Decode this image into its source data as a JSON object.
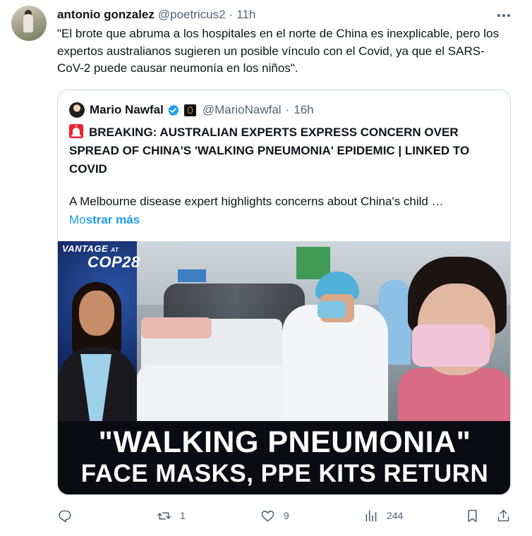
{
  "tweet": {
    "author_name": "antonio gonzalez",
    "author_handle": "@poetricus2",
    "separator": "·",
    "time": "11h",
    "text": "\"El brote que abruma a los hospitales en el norte de China es inexplicable, pero los expertos australianos sugieren un posible vínculo con el Covid, ya que el SARS-CoV-2 puede causar neumonía en los niños\"."
  },
  "quote": {
    "author_name": "Mario Nawfal",
    "author_handle": "@MarioNawfal",
    "separator": "·",
    "time": "16h",
    "headline": "BREAKING: AUSTRALIAN EXPERTS EXPRESS CONCERN OVER SPREAD OF CHINA'S 'WALKING PNEUMONIA' EPIDEMIC | LINKED TO COVID",
    "body": "A Melbourne disease expert highlights concerns about China's child …",
    "show_more_part1": "Mo",
    "show_more_part2": "strar más",
    "media": {
      "brand_top": "VANTAGE",
      "brand_at": "AT",
      "brand_bottom": "COP28",
      "caption_line1": "\"WALKING PNEUMONIA\"",
      "caption_line2": "FACE MASKS, PPE KITS RETURN"
    }
  },
  "actions": {
    "reply_count": "",
    "retweet_count": "1",
    "like_count": "9",
    "views_count": "244"
  },
  "colors": {
    "accent": "#1d9bf0",
    "secondary_text": "#536471",
    "border": "#cfd9de",
    "siren": "#f4212e"
  },
  "icons": [
    "more-icon",
    "verified-badge-icon",
    "affiliate-badge-icon",
    "siren-icon",
    "reply-icon",
    "retweet-icon",
    "like-icon",
    "views-icon",
    "bookmark-icon",
    "share-icon"
  ]
}
